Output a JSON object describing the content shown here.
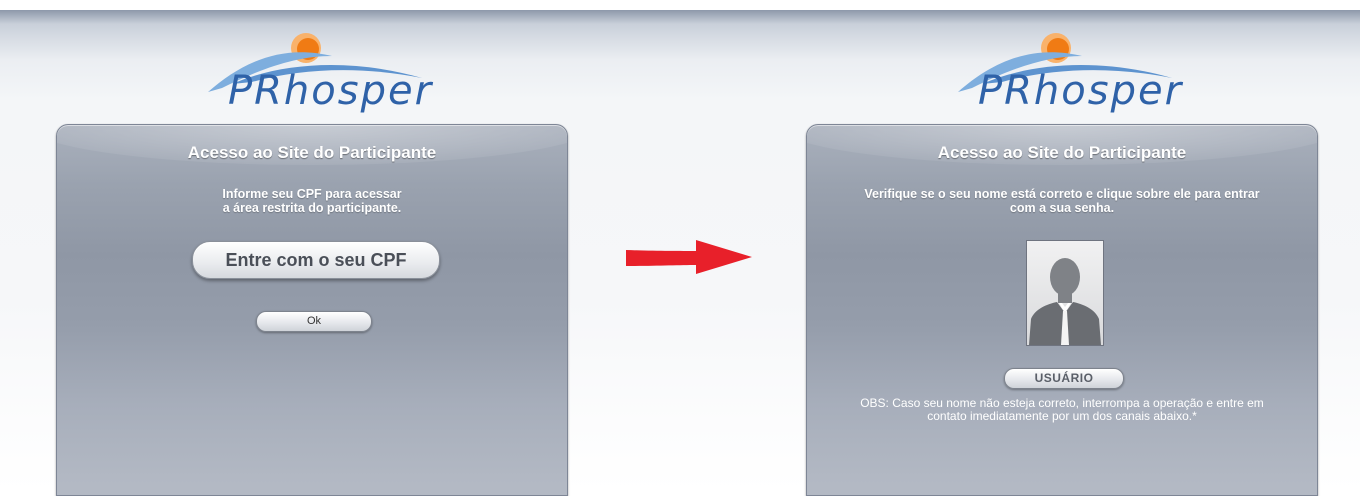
{
  "left_panel": {
    "logo_text": "PRhosper",
    "title": "Acesso ao Site do Participante",
    "instruction_line1": "Informe seu CPF para acessar",
    "instruction_line2": "a área restrita do participante.",
    "cpf_placeholder": "Entre com o seu CPF",
    "ok_label": "Ok"
  },
  "right_panel": {
    "logo_text": "PRhosper",
    "title": "Acesso ao Site do Participante",
    "instruction_line1": "Verifique se o seu nome está correto e clique sobre ele para entrar",
    "instruction_line2": "com a sua senha.",
    "avatar_icon": "user-silhouette-icon",
    "user_label": "USUÁRIO",
    "obs_line1": "OBS: Caso seu nome não esteja correto, interrompa a operação e entre em",
    "obs_line2": "contato imediatamente por um dos canais abaixo.*"
  },
  "arrow_icon": "right-arrow-icon",
  "colors": {
    "arrow": "#e8202a",
    "logo_blue": "#2f62a8",
    "logo_sun": "#f08a1e",
    "panel": "#9aa2af"
  }
}
